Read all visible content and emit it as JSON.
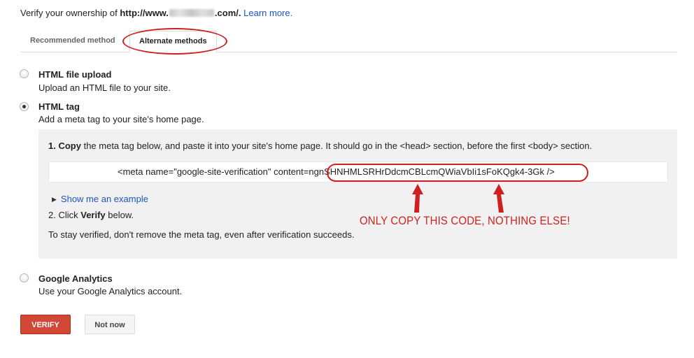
{
  "header": {
    "prefix": "Verify your ownership of ",
    "url_start": "http://www.",
    "url_end": ".com/.",
    "learn_more": "Learn more."
  },
  "tabs": [
    {
      "label": "Recommended method"
    },
    {
      "label": "Alternate methods"
    }
  ],
  "options": [
    {
      "title": "HTML file upload",
      "desc": "Upload an HTML file to your site.",
      "checked": false
    },
    {
      "title": "HTML tag",
      "desc": "Add a meta tag to your site's home page.",
      "checked": true
    },
    {
      "title": "Google Analytics",
      "desc": "Use your Google Analytics account.",
      "checked": false
    }
  ],
  "instructions": {
    "step1_num": "1.",
    "step1_bold": "Copy",
    "step1_rest": " the meta tag below, and paste it into your site's home page. It should go in the <head> section, before the first <body> section.",
    "meta_prefix": "<meta name=\"google-site-verification\" content=",
    "meta_code": "ngnSHNHMLSRHrDdcmCBLcmQWiaVbIi1sFoKQgk4-3Gk",
    "meta_suffix": " />",
    "show_example": "Show me an example",
    "step2_prefix": "2. Click ",
    "step2_bold": "Verify",
    "step2_suffix": " below.",
    "stay_verified": "To stay verified, don't remove the meta tag, even after verification succeeds."
  },
  "annotation": {
    "text": "ONLY COPY THIS CODE, NOTHING ELSE!",
    "color": "#d01f1f"
  },
  "buttons": {
    "verify": "VERIFY",
    "not_now": "Not now"
  },
  "colors": {
    "link": "#1a55c4",
    "verify_bg": "#d14836",
    "panel_bg": "#f1f1f1"
  }
}
